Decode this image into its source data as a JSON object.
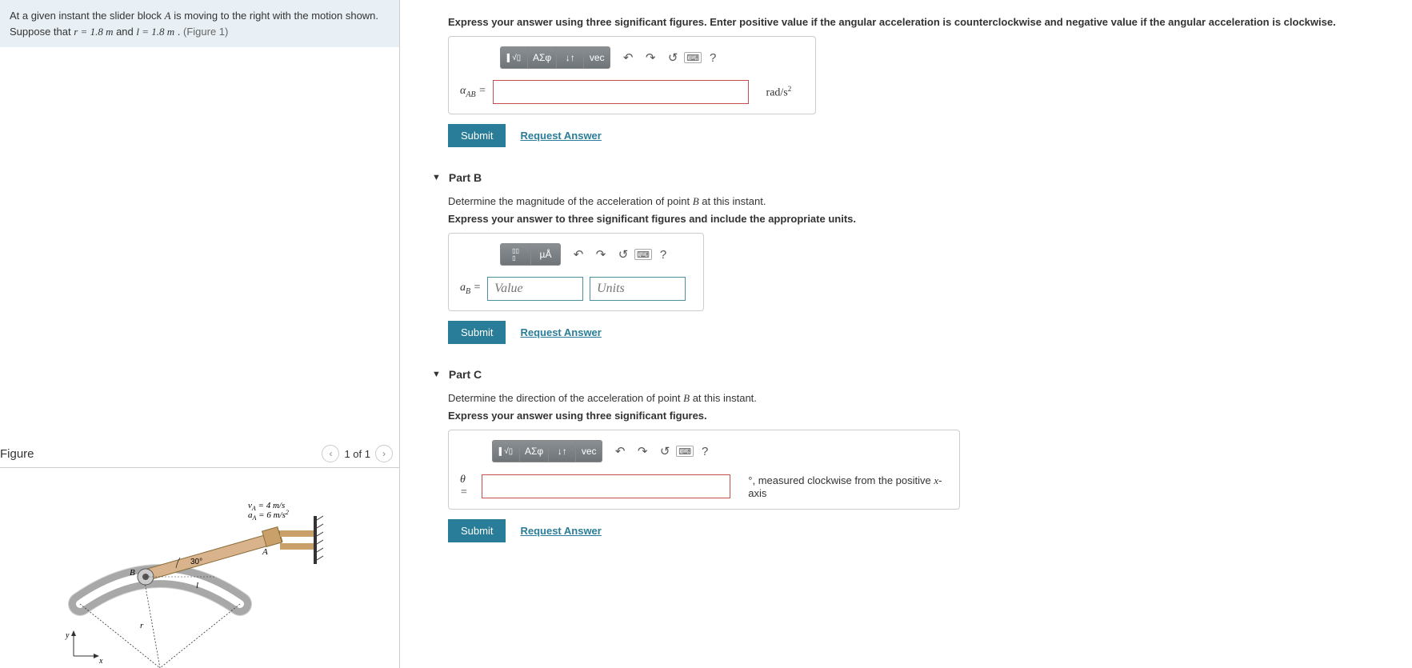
{
  "problem": {
    "text_pre": "At a given instant the slider block ",
    "var_A": "A",
    "text_mid": " is moving to the right with the motion shown. Suppose that ",
    "r_eq": "r = 1.8  m",
    "and": " and ",
    "l_eq": "l = 1.8  m",
    "period": " . ",
    "fig_ref": "(Figure 1)"
  },
  "figure": {
    "title": "Figure",
    "nav_text": "1 of 1",
    "labels": {
      "vA": "v",
      "vA_sub": "A",
      "vA_val": " = 4 m/s",
      "aA": "a",
      "aA_sub": "A",
      "aA_val": " = 6 m/s",
      "aA_sup": "2",
      "angle": "30°",
      "A": "A",
      "B": "B",
      "l": "l",
      "r": "r",
      "x": "x",
      "y": "y"
    }
  },
  "partA": {
    "instruction": "Express your answer using three significant figures. Enter positive value if the angular acceleration is counterclockwise and negative value if the angular acceleration is clockwise.",
    "toolbar": {
      "b1": "■",
      "b2": "√",
      "b3": "ΑΣφ",
      "b4": "↓↑",
      "b5": "vec"
    },
    "var": "α",
    "var_sub": "AB",
    "eq": " = ",
    "unit": "rad/s",
    "unit_sup": "2",
    "submit": "Submit",
    "request": "Request Answer"
  },
  "partB": {
    "title": "Part B",
    "prompt_pre": "Determine the magnitude of the acceleration of point ",
    "prompt_var": "B",
    "prompt_post": " at this instant.",
    "instruction": "Express your answer to three significant figures and include the appropriate units.",
    "toolbar": {
      "b1": "▯",
      "b2": "µÅ"
    },
    "var": "a",
    "var_sub": "B",
    "eq": " = ",
    "value_ph": "Value",
    "units_ph": "Units",
    "submit": "Submit",
    "request": "Request Answer"
  },
  "partC": {
    "title": "Part C",
    "prompt_pre": "Determine the direction of the acceleration of point ",
    "prompt_var": "B",
    "prompt_post": " at this instant.",
    "instruction": "Express your answer using three significant figures.",
    "toolbar": {
      "b1": "■",
      "b2": "√",
      "b3": "ΑΣφ",
      "b4": "↓↑",
      "b5": "vec"
    },
    "var": "θ",
    "eq": " = ",
    "suffix_deg": "°",
    "suffix_text": ", measured clockwise from the positive ",
    "suffix_x": "x",
    "suffix_axis": "-axis",
    "submit": "Submit",
    "request": "Request Answer"
  },
  "icons": {
    "undo": "↶",
    "redo": "↷",
    "reset": "↺",
    "help": "?",
    "prev": "‹",
    "next": "›",
    "caret": "▼"
  }
}
